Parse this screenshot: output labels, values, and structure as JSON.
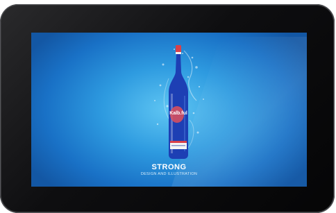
{
  "device": {
    "screen": {
      "title": "STRONG",
      "subtitle": "DESIGN AND ILLUSTRATION"
    },
    "bottle": {
      "label_text": "Kalb.ful"
    }
  },
  "colors": {
    "screen_center": "#5fc6f3",
    "screen_edge": "#1357a4",
    "bottle_glass": "#1d3fb4",
    "cap": "#d8404a"
  },
  "icons": [
    "bottle-illustration"
  ]
}
